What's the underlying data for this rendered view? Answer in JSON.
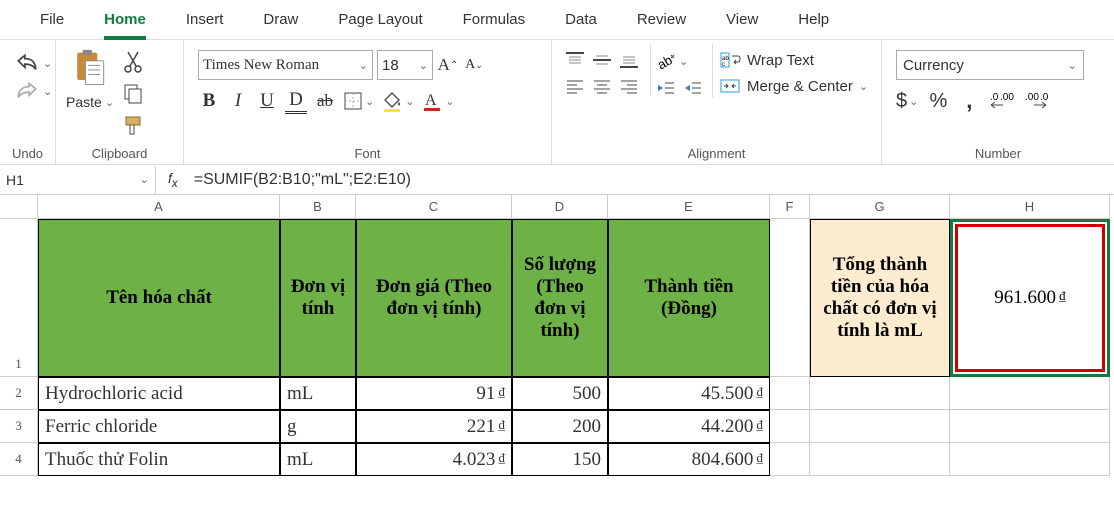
{
  "tabs": {
    "file": "File",
    "home": "Home",
    "insert": "Insert",
    "draw": "Draw",
    "page_layout": "Page Layout",
    "formulas": "Formulas",
    "data": "Data",
    "review": "Review",
    "view": "View",
    "help": "Help"
  },
  "ribbon": {
    "undo_label": "Undo",
    "clipboard_label": "Clipboard",
    "paste": "Paste",
    "font_label": "Font",
    "font_name": "Times New Roman",
    "font_size": "18",
    "align_label": "Alignment",
    "wrap_text": "Wrap Text",
    "merge_center": "Merge & Center",
    "number_label": "Number",
    "number_format": "Currency"
  },
  "formula": {
    "cell_ref": "H1",
    "value": "=SUMIF(B2:B10;\"mL\";E2:E10)"
  },
  "columns": {
    "A": "A",
    "B": "B",
    "C": "C",
    "D": "D",
    "E": "E",
    "F": "F",
    "G": "G",
    "H": "H"
  },
  "row_nums": {
    "r1": "1",
    "r2": "2",
    "r3": "3",
    "r4": "4"
  },
  "headers": {
    "A": "Tên hóa chất",
    "B": "Đơn vị tính",
    "C": "Đơn giá (Theo đơn vị tính)",
    "D": "Số lượng (Theo đơn vị tính)",
    "E": "Thành tiền (Đồng)",
    "G": "Tổng thành tiền của hóa chất có đơn vị tính là mL",
    "H": "961.600",
    "H_cur": "₫"
  },
  "rows": [
    {
      "A": "Hydrochloric acid",
      "B": "mL",
      "C": "91",
      "C_cur": "₫",
      "D": "500",
      "E": "45.500",
      "E_cur": "₫"
    },
    {
      "A": "Ferric chloride",
      "B": "g",
      "C": "221",
      "C_cur": "₫",
      "D": "200",
      "E": "44.200",
      "E_cur": "₫"
    },
    {
      "A": "Thuốc thử Folin",
      "B": "mL",
      "C": "4.023",
      "C_cur": "₫",
      "D": "150",
      "E": "804.600",
      "E_cur": "₫"
    }
  ]
}
